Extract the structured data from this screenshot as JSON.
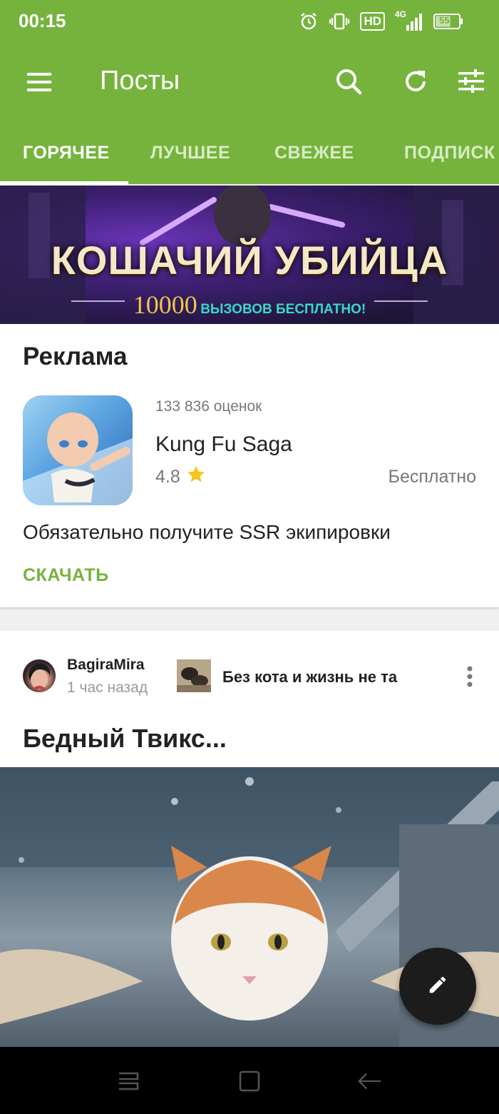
{
  "status_bar": {
    "time": "00:15",
    "network": "4G",
    "hd": "HD",
    "battery": "55",
    "icons": [
      "alarm-icon",
      "vibrate-icon",
      "hd-icon",
      "signal-icon",
      "battery-icon"
    ]
  },
  "toolbar": {
    "title": "Посты",
    "icons": [
      "menu-icon",
      "search-icon",
      "refresh-icon",
      "filter-icon"
    ]
  },
  "tabs": [
    {
      "label": "ГОРЯЧЕЕ",
      "active": true
    },
    {
      "label": "ЛУЧШЕЕ",
      "active": false
    },
    {
      "label": "СВЕЖЕЕ",
      "active": false
    },
    {
      "label": "ПОДПИСК",
      "active": false
    }
  ],
  "banner": {
    "title": "КОШАЧИЙ УБИЙЦА",
    "number": "10000",
    "text": "ВЫЗОВОВ БЕСПЛАТНО!"
  },
  "ad": {
    "label": "Реклама",
    "ratings_count": "133 836  оценок",
    "app_name": "Kung Fu Saga",
    "rating": "4.8",
    "price": "Бесплатно",
    "description": "Обязательно получите SSR экипировки",
    "cta": "СКАЧАТЬ"
  },
  "post": {
    "author": "BagiraMira",
    "time": "1 час назад",
    "community": "Без кота и жизнь не та",
    "title": "Бедный Твикс..."
  },
  "colors": {
    "header": "#76b33d",
    "accent": "#76b33d",
    "fab": "#1c1c1c",
    "star": "#f5c518"
  },
  "fab_icon": "pencil-icon",
  "nav_icons": [
    "recents-icon",
    "home-icon",
    "back-icon"
  ]
}
